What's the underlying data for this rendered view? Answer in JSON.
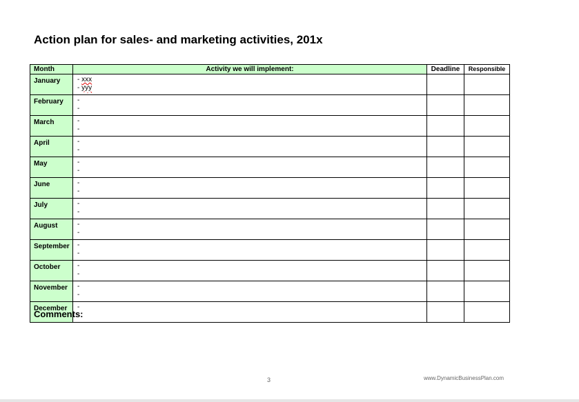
{
  "title": "Action plan for sales- and marketing activities, 201x",
  "table": {
    "headers": {
      "month": "Month",
      "activity": "Activity we will implement:",
      "deadline": "Deadline",
      "responsible": "Responsible"
    },
    "rows": [
      {
        "month": "January",
        "lines": [
          "- xxx",
          "- yyy"
        ]
      },
      {
        "month": "February",
        "lines": [
          "-",
          "-"
        ]
      },
      {
        "month": "March",
        "lines": [
          "-",
          "-"
        ]
      },
      {
        "month": "April",
        "lines": [
          "-",
          "-"
        ]
      },
      {
        "month": "May",
        "lines": [
          "-",
          "-"
        ]
      },
      {
        "month": "June",
        "lines": [
          "-",
          "-"
        ]
      },
      {
        "month": "July",
        "lines": [
          "-",
          "-"
        ]
      },
      {
        "month": "August",
        "lines": [
          "-",
          "-"
        ]
      },
      {
        "month": "September",
        "lines": [
          "-",
          "-"
        ]
      },
      {
        "month": "October",
        "lines": [
          "-",
          "-"
        ]
      },
      {
        "month": "November",
        "lines": [
          "-",
          "-"
        ]
      },
      {
        "month": "December",
        "lines": [
          "-",
          "-"
        ]
      }
    ]
  },
  "comments_label": "Comments:",
  "page_number": "3",
  "footer_url": "www.DynamicBusinessPlan.com",
  "colors": {
    "header_fill": "#ccffcc",
    "spellcheck_underline": "#e00000"
  }
}
